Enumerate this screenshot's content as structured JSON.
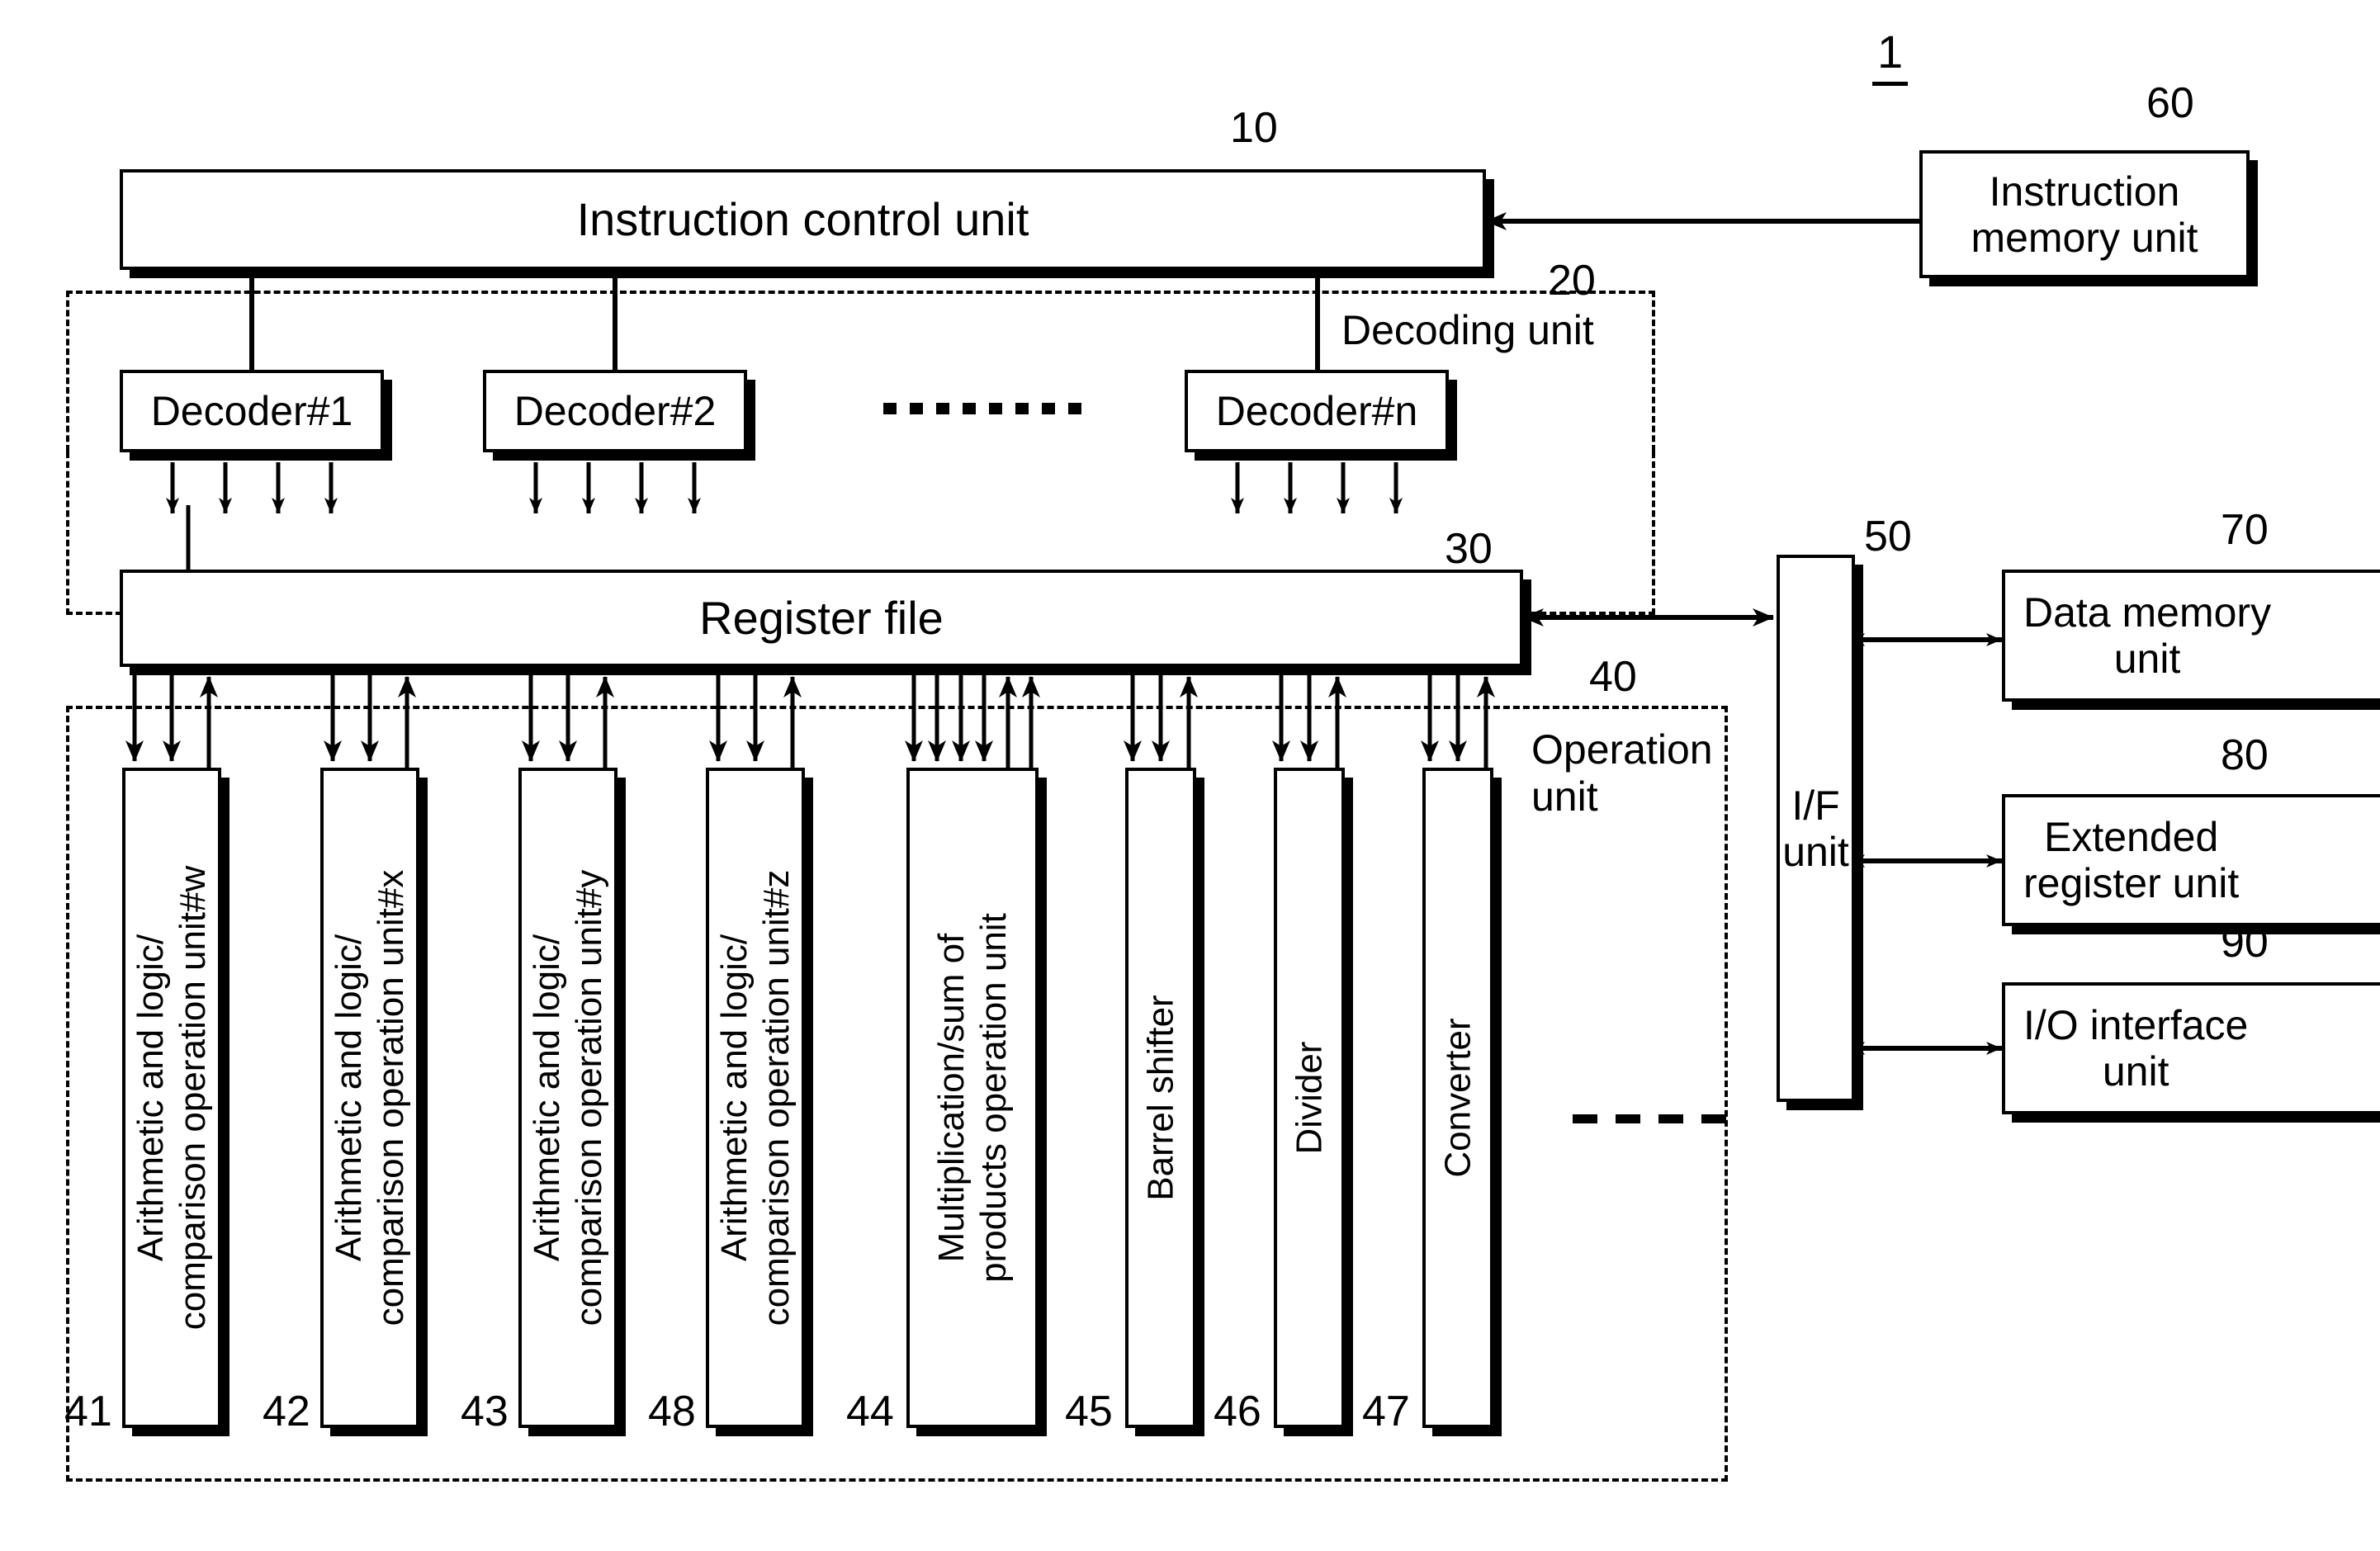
{
  "figure": {
    "system_ref": "1",
    "blocks": {
      "instruction_control_unit": {
        "label": "Instruction control unit",
        "ref": "10"
      },
      "instruction_memory_unit": {
        "label": "Instruction\nmemory unit",
        "ref": "60"
      },
      "decoding_unit": {
        "label": "Decoding unit",
        "ref": "20"
      },
      "register_file": {
        "label": "Register file",
        "ref": "30"
      },
      "operation_unit": {
        "label": "Operation\nunit",
        "ref": "40"
      },
      "if_unit": {
        "label": "I/F\nunit",
        "ref": "50"
      },
      "data_memory_unit": {
        "label": "Data memory\nunit",
        "ref": "70"
      },
      "extended_register_unit": {
        "label": "Extended\nregister unit",
        "ref": "80"
      },
      "io_interface_unit": {
        "label": "I/O interface\nunit",
        "ref": "90"
      }
    },
    "decoders": [
      {
        "label": "Decoder#1"
      },
      {
        "label": "Decoder#2"
      },
      {
        "label": "Decoder#n"
      }
    ],
    "decoder_ellipsis": "........",
    "operation_units": [
      {
        "label": "Arithmetic and logic/\ncomparison operation unit#w",
        "ref": "41"
      },
      {
        "label": "Arithmetic and logic/\ncomparison operation unit#x",
        "ref": "42"
      },
      {
        "label": "Arithmetic and logic/\ncomparison operation unit#y",
        "ref": "43"
      },
      {
        "label": "Arithmetic and logic/\ncomparison operation unit#z",
        "ref": "48"
      },
      {
        "label": "Multiplication/sum of\nproducts operation unit",
        "ref": "44"
      },
      {
        "label": "Barrel shifter",
        "ref": "45"
      },
      {
        "label": "Divider",
        "ref": "46"
      },
      {
        "label": "Converter",
        "ref": "47"
      }
    ],
    "operation_unit_ellipsis": "- - - -",
    "colors": {
      "ink": "#000000",
      "paper": "#ffffff"
    }
  }
}
